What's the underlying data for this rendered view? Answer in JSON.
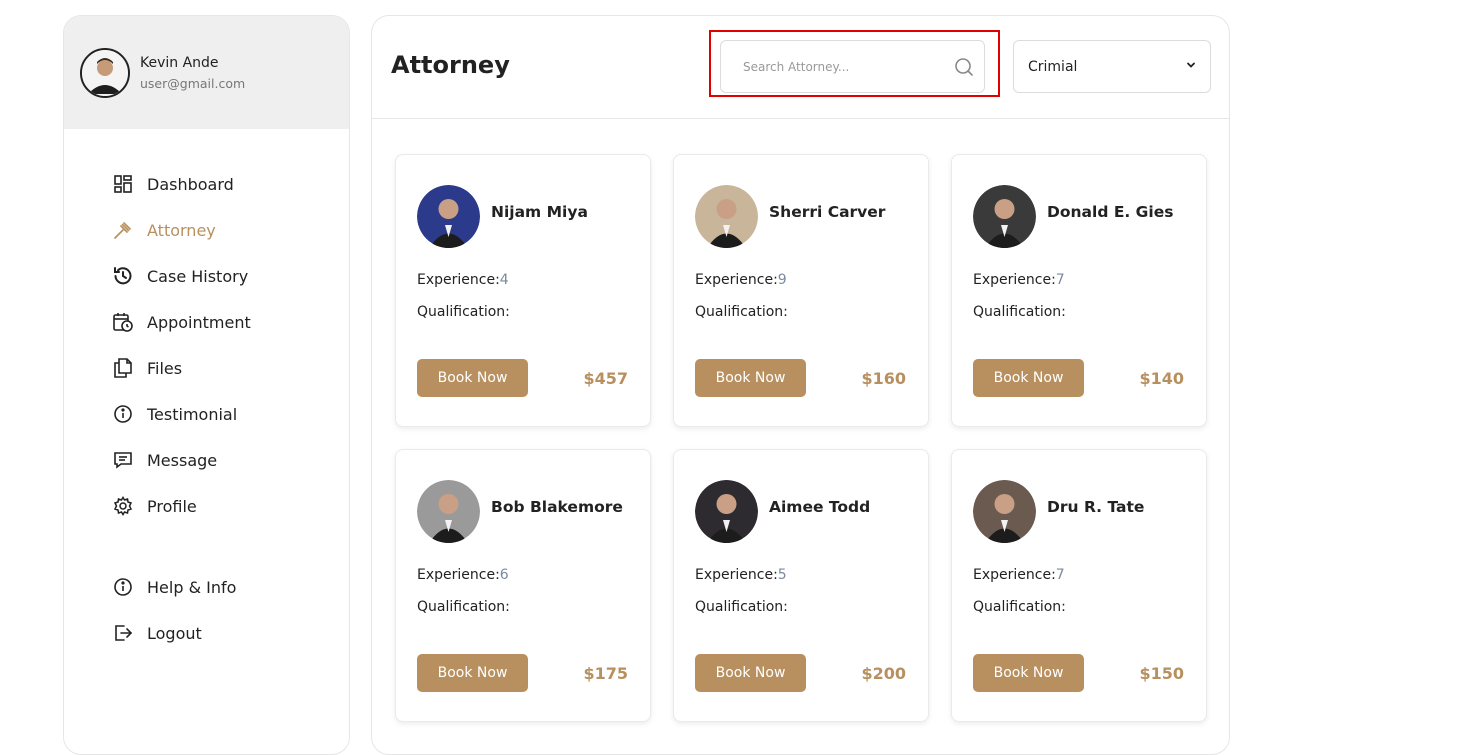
{
  "user": {
    "name": "Kevin Ande",
    "email": "user@gmail.com"
  },
  "nav": [
    {
      "label": "Dashboard",
      "icon": "dashboard-icon"
    },
    {
      "label": "Attorney",
      "icon": "gavel-icon",
      "active": true
    },
    {
      "label": "Case History",
      "icon": "history-icon"
    },
    {
      "label": "Appointment",
      "icon": "calendar-clock-icon"
    },
    {
      "label": "Files",
      "icon": "files-icon"
    },
    {
      "label": "Testimonial",
      "icon": "info-icon"
    },
    {
      "label": "Message",
      "icon": "message-icon"
    },
    {
      "label": "Profile",
      "icon": "gear-icon"
    }
  ],
  "nav_bottom": [
    {
      "label": "Help & Info",
      "icon": "info-icon"
    },
    {
      "label": "Logout",
      "icon": "logout-icon"
    }
  ],
  "page": {
    "title": "Attorney",
    "search_placeholder": "Search Attorney...",
    "category_selected": "Crimial"
  },
  "colors": {
    "accent": "#b8905f",
    "highlight_border": "#e00000"
  },
  "qualification_label": "Qualification:",
  "experience_label": "Experience:",
  "book_label": "Book Now",
  "attorneys": [
    {
      "name": "Nijam Miya",
      "experience": "4",
      "price": "$457",
      "bg": "#2b3a8a"
    },
    {
      "name": "Sherri Carver",
      "experience": "9",
      "price": "$160",
      "bg": "#c8b59a"
    },
    {
      "name": "Donald E. Gies",
      "experience": "7",
      "price": "$140",
      "bg": "#3a3a3a"
    },
    {
      "name": "Bob Blakemore",
      "experience": "6",
      "price": "$175",
      "bg": "#9a9a9a"
    },
    {
      "name": "Aimee Todd",
      "experience": "5",
      "price": "$200",
      "bg": "#2d2a30"
    },
    {
      "name": "Dru R. Tate",
      "experience": "7",
      "price": "$150",
      "bg": "#6a5a50"
    }
  ]
}
